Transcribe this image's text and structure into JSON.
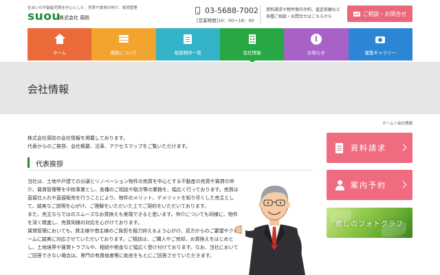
{
  "header": {
    "tagline": "住まいの不動産売買を中心とした、売買や賃貸の仲介、賃貸管理",
    "logo": "suou",
    "company": "株式会社 周防",
    "phone": "03-5688-7002",
    "hours": "[営業時間]10：00～18：00",
    "note_line1": "資料請求や物件案内予約、査定依頼など",
    "note_line2": "各種ご相談・お問合せはこちらから",
    "contact_label": "ご相談・お問合せ"
  },
  "nav": {
    "items": [
      {
        "label": "ホーム",
        "color": "#ec6a3a",
        "icon": "home-icon"
      },
      {
        "label": "周防について",
        "color": "#f2a42e",
        "icon": "stack-icon"
      },
      {
        "label": "取扱物件一覧",
        "color": "#33b3c7",
        "icon": "clipboard-icon"
      },
      {
        "label": "会社情報",
        "color": "#27a845",
        "icon": "building-icon"
      },
      {
        "label": "お知らせ",
        "color": "#a862c7",
        "icon": "info-icon"
      },
      {
        "label": "建築ギャラリー",
        "color": "#2b86d6",
        "icon": "camera-icon"
      }
    ]
  },
  "page": {
    "title": "会社情報",
    "breadcrumb": "ホーム＞会社情報",
    "intro_line1": "株式会社周防の会社情報を掲載しております。",
    "intro_line2": "代表からのご挨拶、会社概要、沿革、アクセスマップをご覧いただけます。",
    "section_title": "代表挨拶",
    "paragraphs": [
      "当社は、土地や戸建ての分譲とリノベーション物件の売買を中心とする不動産の売買や賃貸の仲介、賃貸管理等を中核事業とし、各種のご相談や取次等の業務を、幅広く行っております。売買は直接仕入れや直接販売を行うことにより、物件のメリット、デメリットを知り尽くした売主として、誠実なご説明を心がけ、ご理解をいただいた上でご契約をいただいております。",
      "また、売主ならではのスムーズなお買換えも実現できると思います。仲介についても同様に、物件を深く精査し、売買同様の対応を心がけております。",
      "賃貸管理においても、貸主様や借主様のご負担を極力抑えるよう心がけ、双方からのご要望やクレームに誠実に対応させていただいております。ご相談は、ご購入やご売却、お買換えをはじめとし、土地境界や賃貸トラブルや、相続や税金など幅広く受け付けております。なお、当社においてご回答できない場合は、専門の有資格者等に助言をもとにご回答させていただきます。"
    ]
  },
  "sidebar": {
    "request_label": "資料請求",
    "reserve_label": "案内予約",
    "photo_label": "癒しのフォトグラフ",
    "accent": "#ef6c80"
  }
}
